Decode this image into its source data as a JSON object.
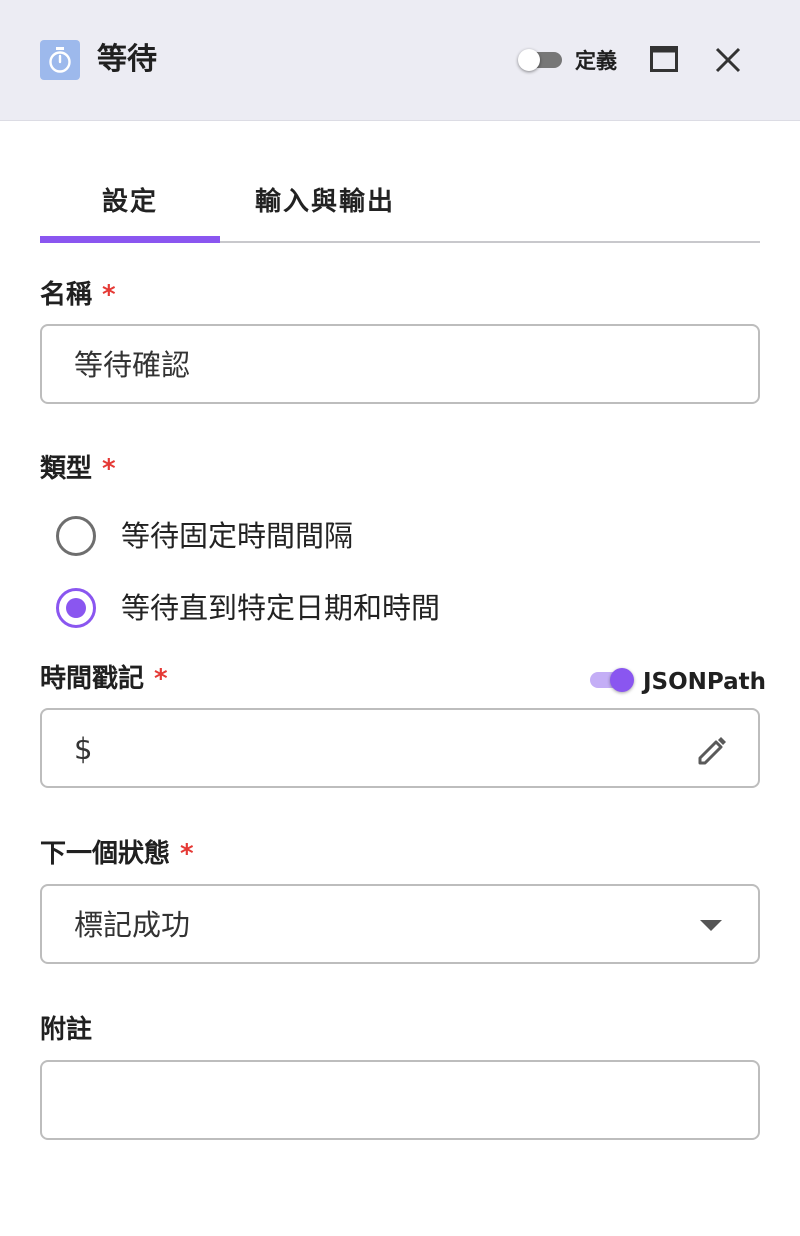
{
  "header": {
    "title": "等待",
    "definition_toggle": {
      "label": "定義",
      "on": false
    },
    "icons": {
      "step": "timer-icon",
      "maximize": "maximize-icon",
      "close": "close-icon"
    }
  },
  "tabs": [
    {
      "label": "設定",
      "active": true
    },
    {
      "label": "輸入與輸出",
      "active": false
    }
  ],
  "form": {
    "name": {
      "label": "名稱",
      "required_mark": "*",
      "value": "等待確認"
    },
    "type": {
      "label": "類型",
      "required_mark": "*",
      "options": [
        {
          "label": "等待固定時間間隔",
          "selected": false
        },
        {
          "label": "等待直到特定日期和時間",
          "selected": true
        }
      ]
    },
    "timestamp": {
      "label": "時間戳記",
      "required_mark": "*",
      "value": "$",
      "jsonpath_toggle": {
        "label": "JSONPath",
        "on": true
      }
    },
    "next_state": {
      "label": "下一個狀態",
      "required_mark": "*",
      "value": "標記成功"
    },
    "comment": {
      "label": "附註",
      "value": ""
    }
  },
  "colors": {
    "accent": "#8a56f0",
    "required": "#e53935",
    "header_bg": "#ececf3",
    "step_icon_bg": "#9db9ec"
  }
}
